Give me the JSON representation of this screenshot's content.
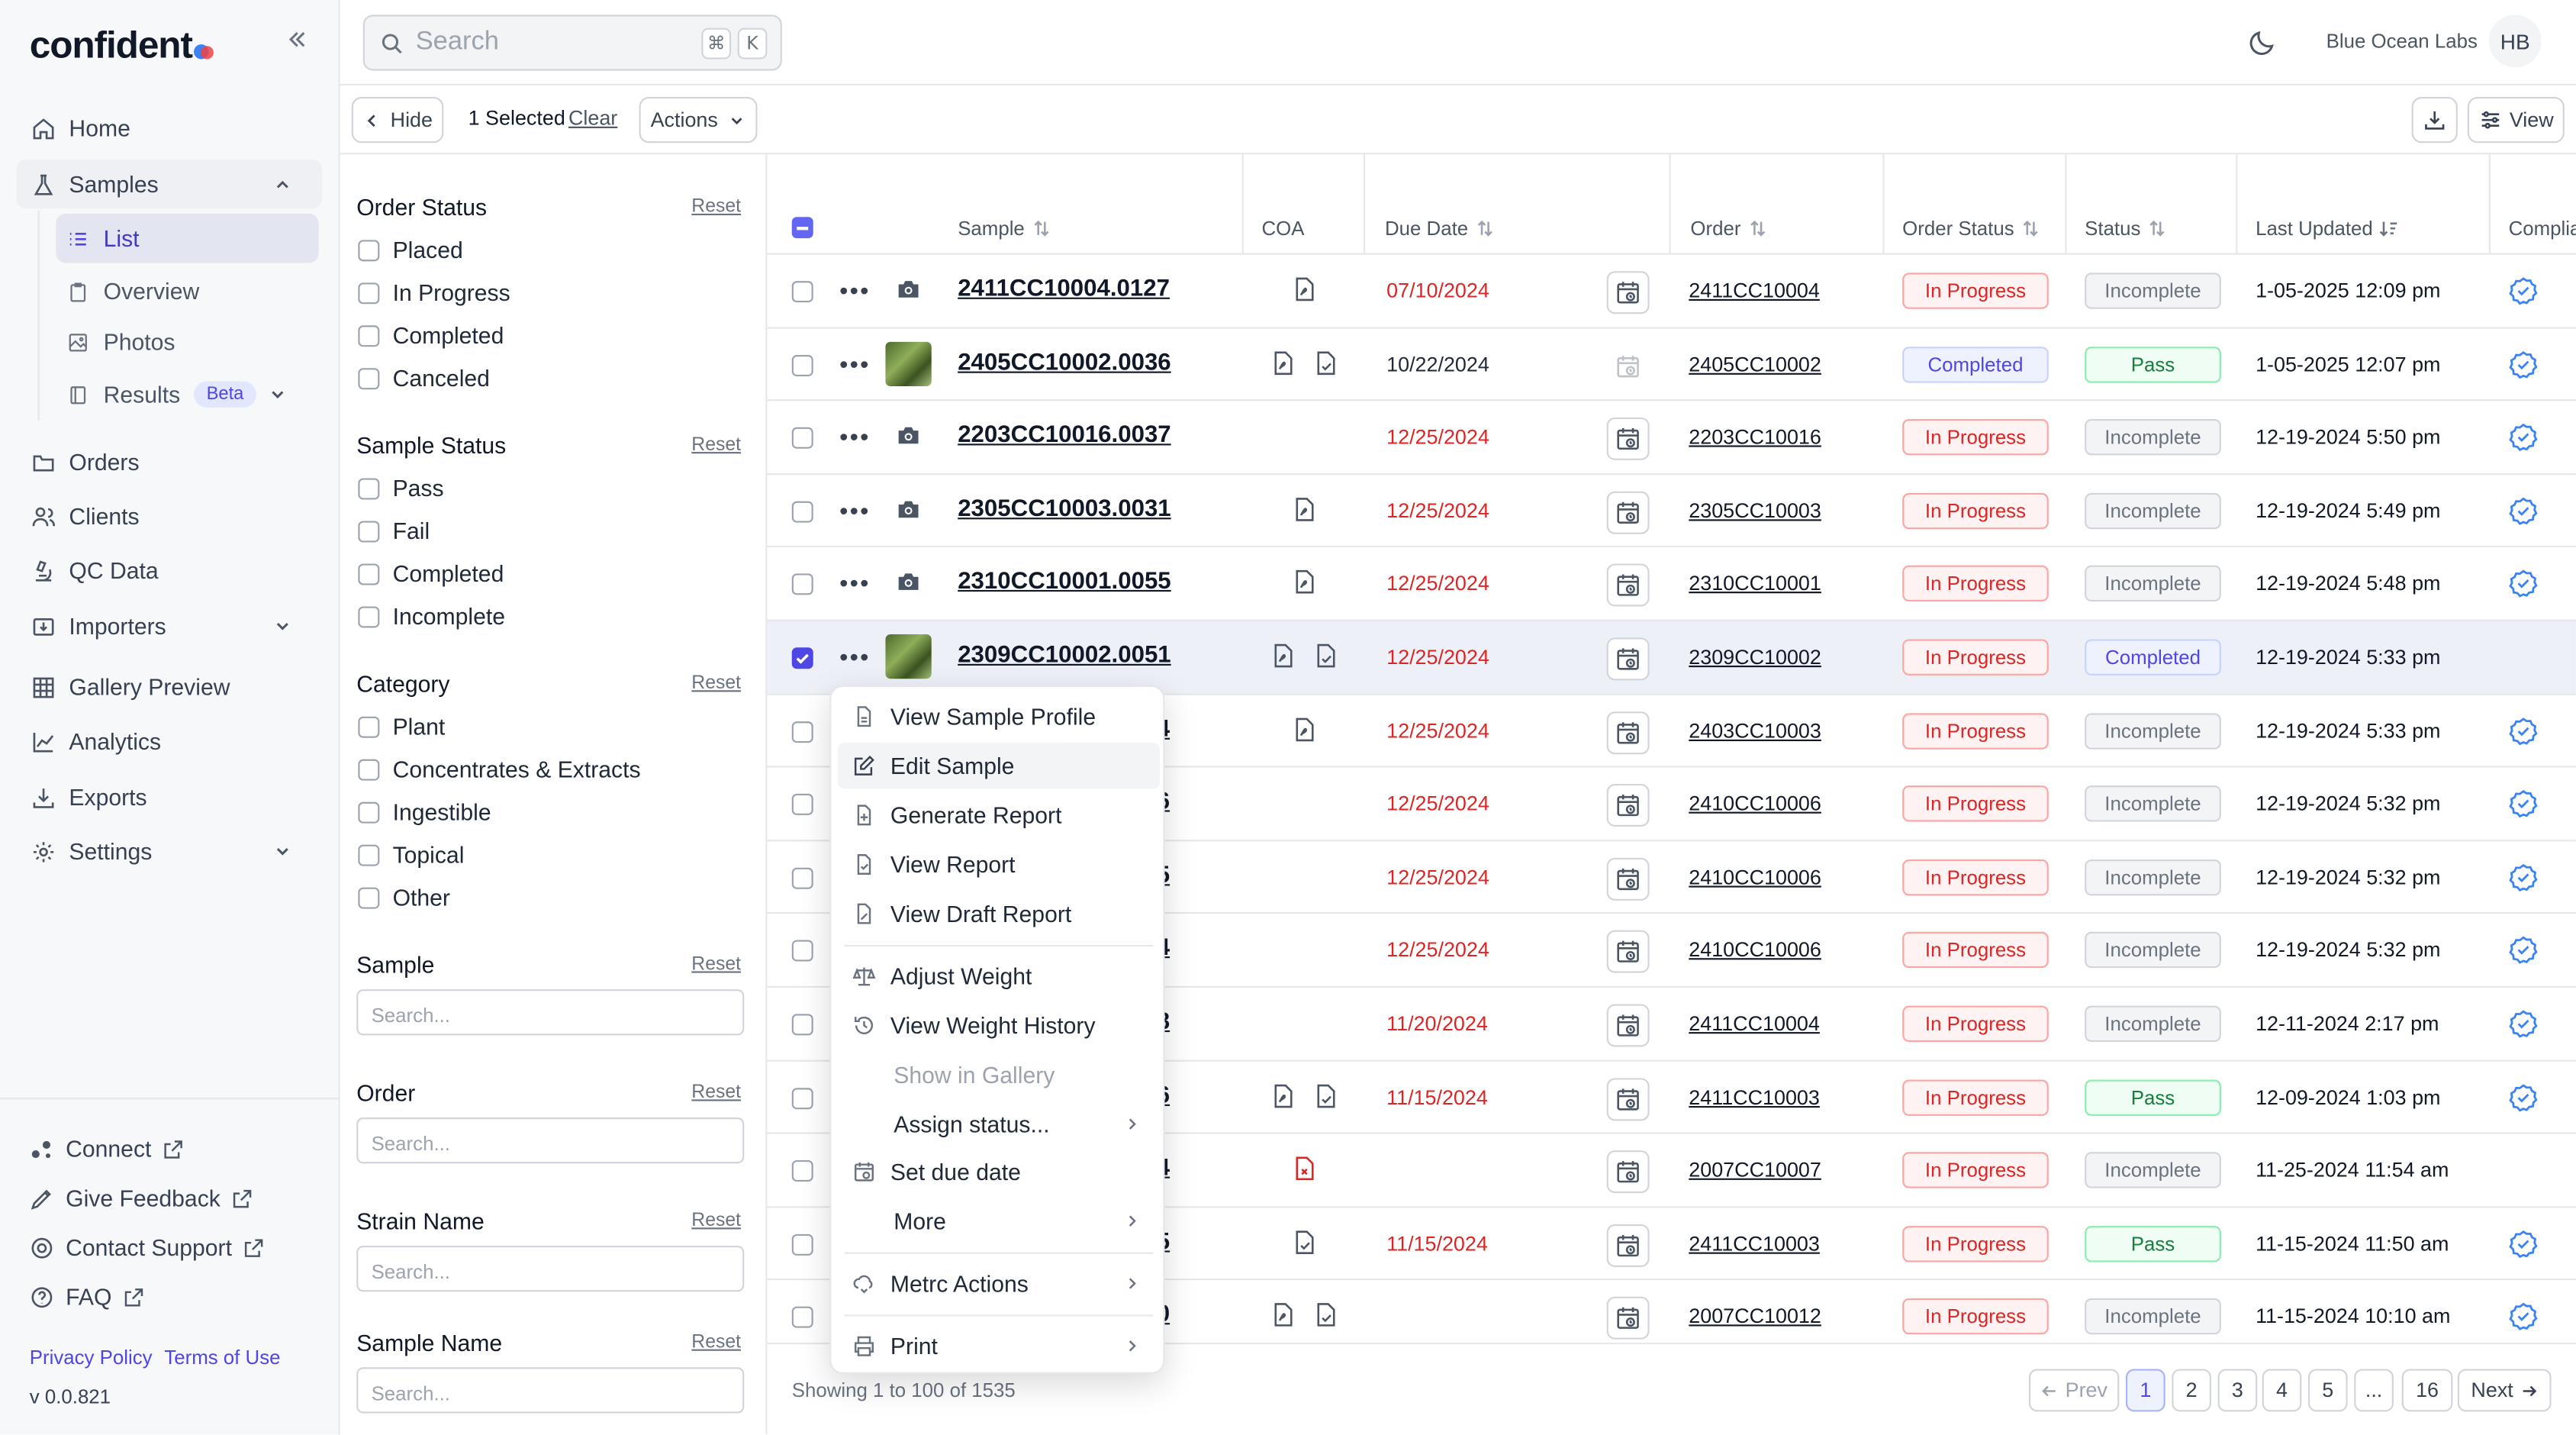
{
  "app": {
    "logo": "confident",
    "version": "v 0.0.821",
    "org": "Blue Ocean Labs",
    "avatar": "HB"
  },
  "nav": {
    "home": "Home",
    "samples": "Samples",
    "list": "List",
    "overview": "Overview",
    "photos": "Photos",
    "results": "Results",
    "beta": "Beta",
    "orders": "Orders",
    "clients": "Clients",
    "qc": "QC Data",
    "importers": "Importers",
    "gallery": "Gallery Preview",
    "analytics": "Analytics",
    "exports": "Exports",
    "settings": "Settings"
  },
  "footer": {
    "connect": "Connect",
    "feedback": "Give Feedback",
    "support": "Contact Support",
    "faq": "FAQ",
    "privacy": "Privacy Policy",
    "terms": "Terms of Use"
  },
  "search": {
    "placeholder": "Search",
    "k1": "⌘",
    "k2": "K"
  },
  "toolbar": {
    "hide": "Hide",
    "selected": "1 Selected",
    "clear": "Clear",
    "actions": "Actions",
    "view": "View"
  },
  "filters": {
    "reset": "Reset",
    "order_status": {
      "title": "Order Status",
      "options": [
        "Placed",
        "In Progress",
        "Completed",
        "Canceled"
      ]
    },
    "sample_status": {
      "title": "Sample Status",
      "options": [
        "Pass",
        "Fail",
        "Completed",
        "Incomplete"
      ]
    },
    "category": {
      "title": "Category",
      "options": [
        "Plant",
        "Concentrates & Extracts",
        "Ingestible",
        "Topical",
        "Other"
      ]
    },
    "sample": {
      "title": "Sample",
      "placeholder": "Search..."
    },
    "order": {
      "title": "Order",
      "placeholder": "Search..."
    },
    "strain": {
      "title": "Strain Name",
      "placeholder": "Search..."
    },
    "sample_name": {
      "title": "Sample Name",
      "placeholder": "Search..."
    }
  },
  "table": {
    "headers": {
      "sample": "Sample",
      "coa": "COA",
      "due": "Due Date",
      "order": "Order",
      "order_status": "Order Status",
      "status": "Status",
      "updated": "Last Updated",
      "compliance": "Complia"
    },
    "rows": [
      {
        "sample": "2411CC10004.0127",
        "due": "07/10/2024",
        "order": "2411CC10004",
        "order_status": "In Progress",
        "status": "Incomplete",
        "updated": "1-05-2025 12:09 pm"
      },
      {
        "sample": "2405CC10002.0036",
        "due": "10/22/2024",
        "order": "2405CC10002",
        "order_status": "Completed",
        "status": "Pass",
        "updated": "1-05-2025 12:07 pm"
      },
      {
        "sample": "2203CC10016.0037",
        "due": "12/25/2024",
        "order": "2203CC10016",
        "order_status": "In Progress",
        "status": "Incomplete",
        "updated": "12-19-2024 5:50 pm"
      },
      {
        "sample": "2305CC10003.0031",
        "due": "12/25/2024",
        "order": "2305CC10003",
        "order_status": "In Progress",
        "status": "Incomplete",
        "updated": "12-19-2024 5:49 pm"
      },
      {
        "sample": "2310CC10001.0055",
        "due": "12/25/2024",
        "order": "2310CC10001",
        "order_status": "In Progress",
        "status": "Incomplete",
        "updated": "12-19-2024 5:48 pm"
      },
      {
        "sample": "2309CC10002.0051",
        "due": "12/25/2024",
        "order": "2309CC10002",
        "order_status": "In Progress",
        "status": "Completed",
        "updated": "12-19-2024 5:33 pm"
      },
      {
        "sample": "4",
        "due": "12/25/2024",
        "order": "2403CC10003",
        "order_status": "In Progress",
        "status": "Incomplete",
        "updated": "12-19-2024 5:33 pm"
      },
      {
        "sample": "6",
        "due": "12/25/2024",
        "order": "2410CC10006",
        "order_status": "In Progress",
        "status": "Incomplete",
        "updated": "12-19-2024 5:32 pm"
      },
      {
        "sample": "5",
        "due": "12/25/2024",
        "order": "2410CC10006",
        "order_status": "In Progress",
        "status": "Incomplete",
        "updated": "12-19-2024 5:32 pm"
      },
      {
        "sample": "4",
        "due": "12/25/2024",
        "order": "2410CC10006",
        "order_status": "In Progress",
        "status": "Incomplete",
        "updated": "12-19-2024 5:32 pm"
      },
      {
        "sample": "8",
        "due": "11/20/2024",
        "order": "2411CC10004",
        "order_status": "In Progress",
        "status": "Incomplete",
        "updated": "12-11-2024 2:17 pm"
      },
      {
        "sample": "6",
        "due": "11/15/2024",
        "order": "2411CC10003",
        "order_status": "In Progress",
        "status": "Pass",
        "updated": "12-09-2024 1:03 pm"
      },
      {
        "sample": "4",
        "due": "",
        "order": "2007CC10007",
        "order_status": "In Progress",
        "status": "Incomplete",
        "updated": "11-25-2024 11:54 am"
      },
      {
        "sample": "5",
        "due": "11/15/2024",
        "order": "2411CC10003",
        "order_status": "In Progress",
        "status": "Pass",
        "updated": "11-15-2024 11:50 am"
      },
      {
        "sample": "0",
        "due": "",
        "order": "2007CC10012",
        "order_status": "In Progress",
        "status": "Incomplete",
        "updated": "11-15-2024 10:10 am"
      }
    ]
  },
  "pagination": {
    "summary": "Showing 1 to 100 of 1535",
    "prev": "Prev",
    "next": "Next",
    "pages": [
      "1",
      "2",
      "3",
      "4",
      "5",
      "...",
      "16"
    ]
  },
  "menu": {
    "view_profile": "View Sample Profile",
    "edit": "Edit Sample",
    "generate": "Generate Report",
    "view_report": "View Report",
    "view_draft": "View Draft Report",
    "adjust": "Adjust Weight",
    "history": "View Weight History",
    "gallery": "Show in Gallery",
    "assign": "Assign status...",
    "due": "Set due date",
    "more": "More",
    "metrc": "Metrc Actions",
    "print": "Print"
  },
  "colors": {
    "accent": "#4f46e5",
    "danger": "#dc2626",
    "success": "#15803d"
  }
}
